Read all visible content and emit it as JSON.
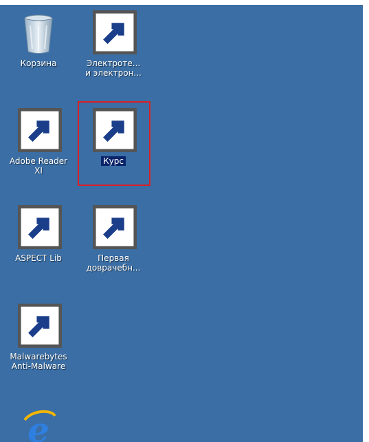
{
  "desktop": {
    "background_color": "#3a6ea5",
    "icons": [
      {
        "label": "Корзина",
        "icon": "recycle-bin-icon"
      },
      {
        "label": "Электроте...\nи электрон...",
        "icon": "books-icon"
      },
      {
        "label": "Adobe Reader\nXI",
        "icon": "adobe-reader-icon"
      },
      {
        "label": "Курс",
        "icon": "course-okk-icon",
        "selected": true
      },
      {
        "label": "ASPECT Lib",
        "icon": "aspect-lib-icon"
      },
      {
        "label": "Первая\nдоврачебн...",
        "icon": "first-aid-icon"
      },
      {
        "label": "Malwarebytes\nAnti-Malware",
        "icon": "malwarebytes-icon"
      },
      {
        "label": "",
        "icon": "internet-explorer-icon"
      }
    ],
    "selection_color": "#d91f26"
  }
}
